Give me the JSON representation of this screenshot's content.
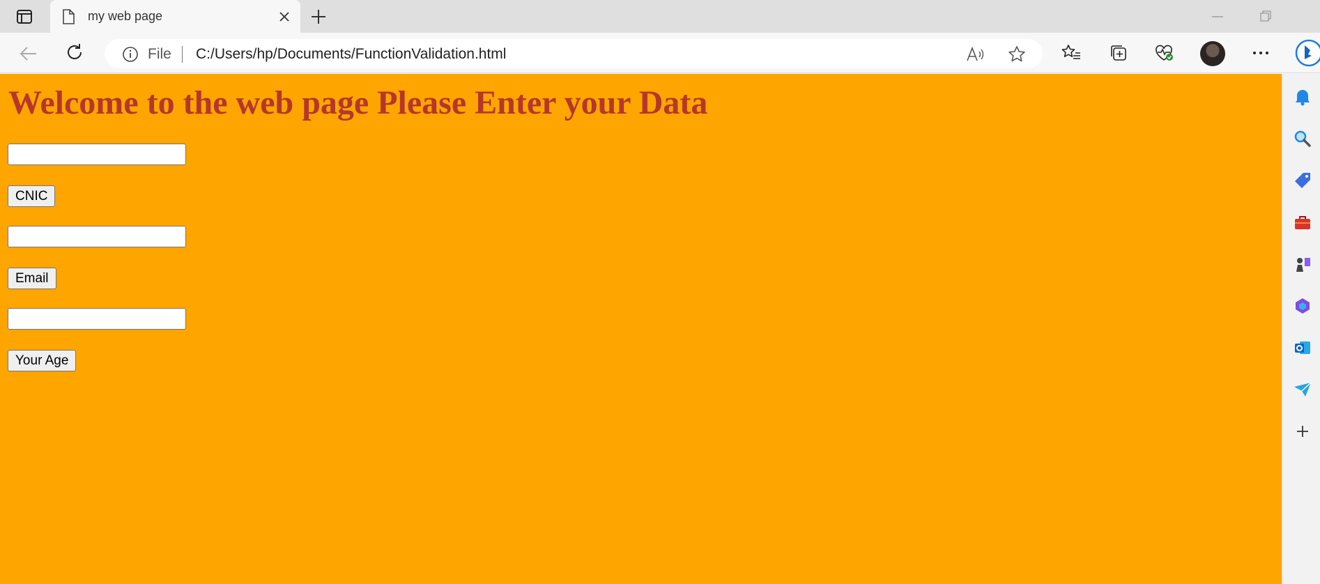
{
  "browser": {
    "tab": {
      "title": "my web page",
      "favicon": "page-icon"
    },
    "address": {
      "scheme_label": "File",
      "url": "C:/Users/hp/Documents/FunctionValidation.html"
    },
    "toolbar_icons": [
      "favorites-icon",
      "collections-icon",
      "browser-essentials-icon",
      "profile-avatar",
      "more-icon"
    ],
    "sidebar_icons": [
      "bell-icon",
      "search-icon",
      "shopping-tag-icon",
      "tools-icon",
      "games-icon",
      "microsoft365-icon",
      "outlook-icon",
      "drop-icon",
      "add-icon"
    ]
  },
  "page": {
    "background_color": "#ffa500",
    "heading": "Welcome to the web page Please Enter your Data",
    "heading_color": "#b5372a",
    "fields": [
      {
        "value": "",
        "button_label": "CNIC"
      },
      {
        "value": "",
        "button_label": "Email"
      },
      {
        "value": "",
        "button_label": "Your Age"
      }
    ]
  }
}
